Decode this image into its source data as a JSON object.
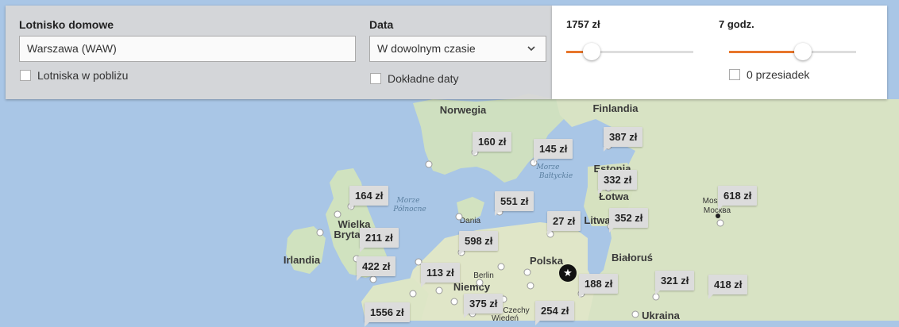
{
  "form": {
    "home_airport_label": "Lotnisko domowe",
    "home_airport_value": "Warszawa (WAW)",
    "nearby_label": "Lotniska w pobliżu",
    "date_label": "Data",
    "date_value": "W dowolnym czasie",
    "exact_dates_label": "Dokładne daty"
  },
  "filters": {
    "price_label": "1757 zł",
    "price_fraction": 0.2,
    "duration_label": "7 godz.",
    "duration_fraction": 0.58,
    "nonstop_label": "0 przesiadek",
    "accent_color": "#e8762b"
  },
  "map": {
    "countries": [
      "Norwegia",
      "Finlandia",
      "Estonia",
      "Łotwa",
      "Litwa",
      "Białoruś",
      "Polska",
      "Niemcy",
      "Ukraina",
      "Irlandia",
      "Wielka",
      "Bryta",
      "Dania",
      "Czechy"
    ],
    "seas": [
      "Morze",
      "Bałtyckie",
      "Morze",
      "Północne"
    ],
    "cities": [
      "Moskwa",
      "Москва",
      "Berlin",
      "Wiedeń"
    ],
    "prices": [
      "160 zł",
      "145 zł",
      "387 zł",
      "332 zł",
      "164 zł",
      "551 zł",
      "618 zł",
      "27 zł",
      "352 zł",
      "211 zł",
      "598 zł",
      "422 zł",
      "113 zł",
      "188 zł",
      "321 zł",
      "418 zł",
      "375 zł",
      "1556 zł",
      "254 zł"
    ]
  }
}
